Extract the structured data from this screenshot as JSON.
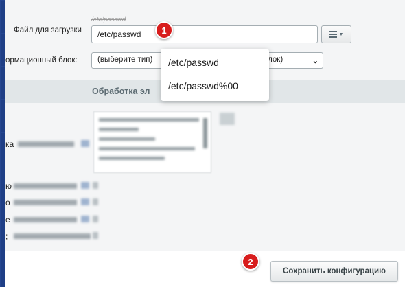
{
  "form": {
    "file_label": "Файл для загрузки",
    "file_previous": "/etc/passwd",
    "file_value": "/etc/passwd",
    "infoblock_label": "ормационный блок:",
    "infoblock_value_left": "(выберите тип)",
    "infoblock_value_right": "блок)"
  },
  "autocomplete": {
    "items": [
      "/etc/passwd",
      "/etc/passwd%00"
    ]
  },
  "section": {
    "header": "Обработка эл"
  },
  "rows": {
    "prefix_1": "ка",
    "prefix_2": "ю",
    "prefix_3": "о",
    "prefix_4": "е",
    "prefix_5": ";"
  },
  "footer": {
    "save_label": "Сохранить конфигурацию"
  },
  "annotations": {
    "badge_1": "1",
    "badge_2": "2"
  },
  "colors": {
    "background": "#1f3f86",
    "panel": "#f4f5f6",
    "header": "#e1e6e8",
    "badge": "#d81d1d"
  }
}
